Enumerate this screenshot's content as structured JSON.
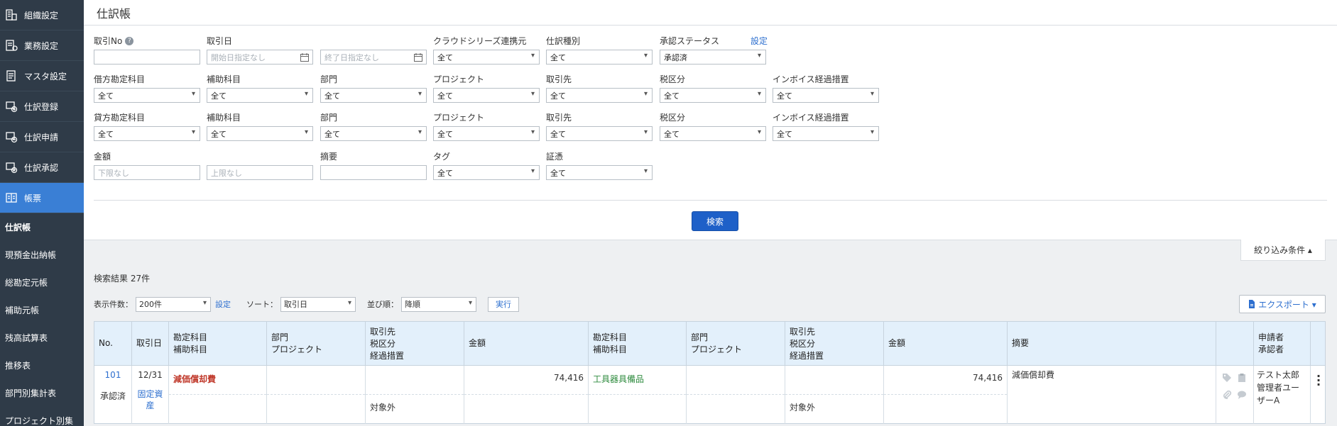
{
  "sidebar": {
    "main_items": [
      {
        "label": "組織設定",
        "icon": "building-icon"
      },
      {
        "label": "業務設定",
        "icon": "settings-doc-icon"
      },
      {
        "label": "マスタ設定",
        "icon": "master-icon"
      },
      {
        "label": "仕訳登録",
        "icon": "journal-add-icon"
      },
      {
        "label": "仕訳申請",
        "icon": "journal-request-icon"
      },
      {
        "label": "仕訳承認",
        "icon": "journal-approve-icon"
      },
      {
        "label": "帳票",
        "icon": "report-icon"
      }
    ],
    "sub_items": [
      "仕訳帳",
      "現預金出納帳",
      "総勘定元帳",
      "補助元帳",
      "残高試算表",
      "推移表",
      "部門別集計表",
      "プロジェクト別集"
    ]
  },
  "header": {
    "title": "仕訳帳"
  },
  "filters": {
    "row1": {
      "torihiki_no": "取引No",
      "torihiki_date": "取引日",
      "start_placeholder": "開始日指定なし",
      "end_placeholder": "終了日指定なし",
      "cloud": "クラウドシリーズ連携元",
      "cloud_value": "全て",
      "shiwake_type": "仕訳種別",
      "shiwake_type_value": "全て",
      "approval": "承認ステータス",
      "approval_link": "設定",
      "approval_value": "承認済"
    },
    "row2": {
      "labels": [
        "借方勘定科目",
        "補助科目",
        "部門",
        "プロジェクト",
        "取引先",
        "税区分",
        "インボイス経過措置"
      ],
      "value": "全て"
    },
    "row3": {
      "labels": [
        "貸方勘定科目",
        "補助科目",
        "部門",
        "プロジェクト",
        "取引先",
        "税区分",
        "インボイス経過措置"
      ],
      "value": "全て"
    },
    "row4": {
      "amount": "金額",
      "min_placeholder": "下限なし",
      "max_placeholder": "上限なし",
      "memo": "摘要",
      "tag": "タグ",
      "tag_value": "全て",
      "evidence": "証憑",
      "evidence_value": "全て"
    },
    "search_button": "検索",
    "collapse_label": "絞り込み条件 ▴"
  },
  "results": {
    "count_text": "検索結果 27件",
    "display_label": "表示件数：",
    "display_value": "200件",
    "display_link": "設定",
    "sort_label": "ソート：",
    "sort_value": "取引日",
    "order_label": "並び順：",
    "order_value": "降順",
    "exec_button": "実行",
    "export_button": "エクスポート ▾"
  },
  "table": {
    "headers": {
      "no": "No.",
      "date": "取引日",
      "acct1": "勘定科目",
      "sub1": "補助科目",
      "dept1": "部門",
      "proj1": "プロジェクト",
      "partner1": "取引先",
      "tax1": "税区分",
      "invoice1": "経過措置",
      "amount1": "金額",
      "acct2": "勘定科目",
      "sub2": "補助科目",
      "dept2": "部門",
      "proj2": "プロジェクト",
      "partner2": "取引先",
      "tax2": "税区分",
      "invoice2": "経過措置",
      "amount2": "金額",
      "memo": "摘要",
      "applicant": "申請者",
      "approver": "承認者"
    },
    "row": {
      "no": "101",
      "status": "承認済",
      "date": "12/31",
      "type_link_1": "固定資",
      "type_link_2": "産",
      "debit_account": "減価償却費",
      "debit_tax": "対象外",
      "debit_amount": "74,416",
      "credit_account": "工具器具備品",
      "credit_tax": "対象外",
      "credit_amount": "74,416",
      "memo": "減価償却費",
      "applicant": "テスト太郎",
      "approver_1": "管理者ユー",
      "approver_2": "ザーA"
    }
  },
  "colors": {
    "sidebar_bg": "#2f3b48",
    "sidebar_active": "#3a7fd5",
    "primary_button": "#1e60c8",
    "link": "#2d6fcf",
    "debit_account": "#c0392b",
    "credit_account": "#2e8b3e",
    "table_header_bg": "#e3f0fb"
  }
}
